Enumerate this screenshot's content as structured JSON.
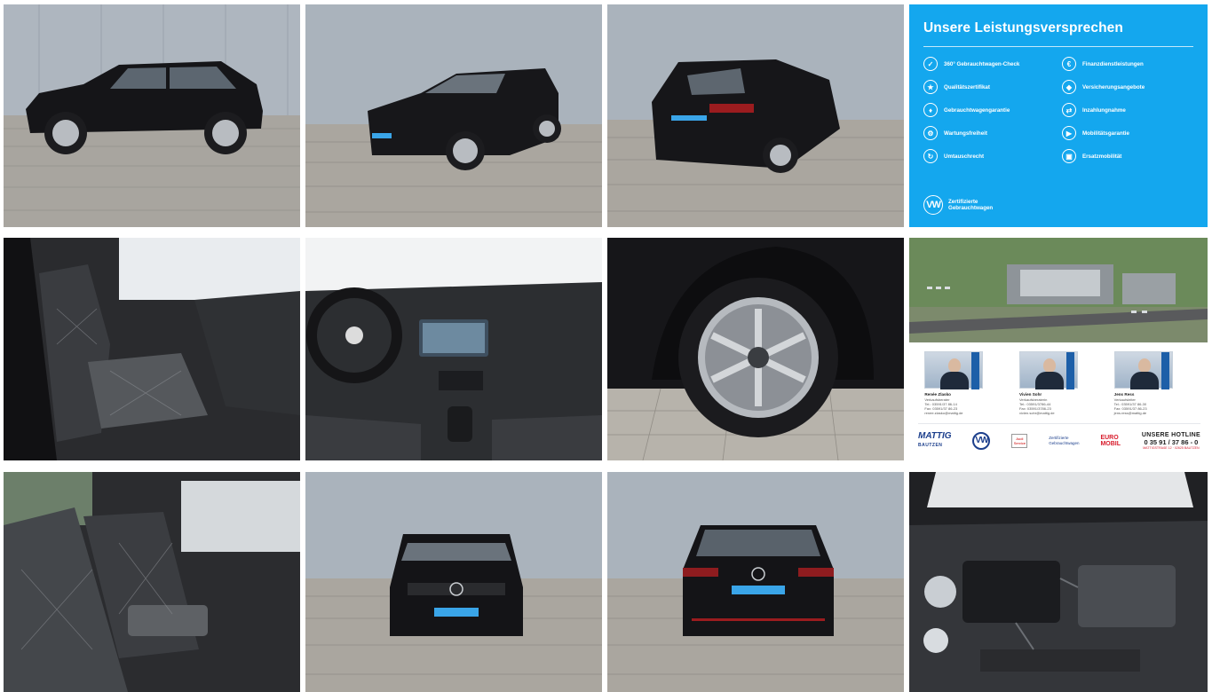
{
  "gallery": {
    "photos": [
      {
        "name": "photo-side-profile",
        "alt": "side profile"
      },
      {
        "name": "photo-front-three-quarter",
        "alt": "front three-quarter"
      },
      {
        "name": "photo-rear-three-quarter",
        "alt": "rear three-quarter"
      },
      {
        "name": "photo-front-seats",
        "alt": "front seats"
      },
      {
        "name": "photo-cockpit",
        "alt": "cockpit"
      },
      {
        "name": "photo-wheel",
        "alt": "wheel"
      },
      {
        "name": "photo-rear-seats",
        "alt": "rear seats"
      },
      {
        "name": "photo-front",
        "alt": "front"
      },
      {
        "name": "photo-rear",
        "alt": "rear"
      },
      {
        "name": "photo-engine-bay",
        "alt": "engine bay"
      }
    ]
  },
  "promise_card": {
    "title": "Unsere Leistungsversprechen",
    "items": [
      {
        "label": "360° Gebrauchtwagen-Check",
        "icon": "check-car-icon"
      },
      {
        "label": "Finanzdienstleistungen",
        "icon": "finance-icon"
      },
      {
        "label": "Qualitätszertifikat",
        "icon": "certificate-icon"
      },
      {
        "label": "Versicherungsangebote",
        "icon": "insurance-icon"
      },
      {
        "label": "Gebrauchtwagengarantie",
        "icon": "warranty-icon"
      },
      {
        "label": "Inzahlungnahme",
        "icon": "trade-in-icon"
      },
      {
        "label": "Wartungsfreiheit",
        "icon": "maintenance-icon"
      },
      {
        "label": "Mobilitätsgarantie",
        "icon": "mobility-icon"
      },
      {
        "label": "Umtauschrecht",
        "icon": "exchange-icon"
      },
      {
        "label": "Ersatzmobilität",
        "icon": "replacement-car-icon"
      }
    ],
    "footer_line1": "Zertifizierte",
    "footer_line2": "Gebrauchtwagen",
    "accent_color": "#14a7ee"
  },
  "dealer_card": {
    "staff": [
      {
        "name": "Renée Zlasko",
        "role": "Verkaufsberater",
        "tel": "Tel.: 03591/37 86-14",
        "fax": "Fax: 03591/37 86-23",
        "mail": "renee.zlasko@mattig.de"
      },
      {
        "name": "Vivien Sohr",
        "role": "Verkaufsberaterin",
        "tel": "Tel.: 03591/3786-44",
        "fax": "Fax: 03591/3786-23",
        "mail": "vivien.sohr@mattig.de"
      },
      {
        "name": "Jens Ress",
        "role": "Verkaufsleiter",
        "tel": "Tel.: 03591/37 86-30",
        "fax": "Fax: 03591/37 86-23",
        "mail": "jens.ress@mattig.de"
      }
    ],
    "logo_mattig": "MATTIG",
    "logo_city": "BAUTZEN",
    "logo_vw": "VW",
    "logo_audi": "Audi Service",
    "logo_zg_1": "Zertifizierte",
    "logo_zg_2": "Gebrauchtwagen",
    "logo_euro_1": "EURO",
    "logo_euro_2": "MOBIL",
    "hotline_title": "UNSERE HOTLINE",
    "hotline_number": "0 35 91 / 37 86 - 0",
    "hotline_sub": "MATTIGSTRAßE 12 · 02625 BAUTZEN"
  }
}
